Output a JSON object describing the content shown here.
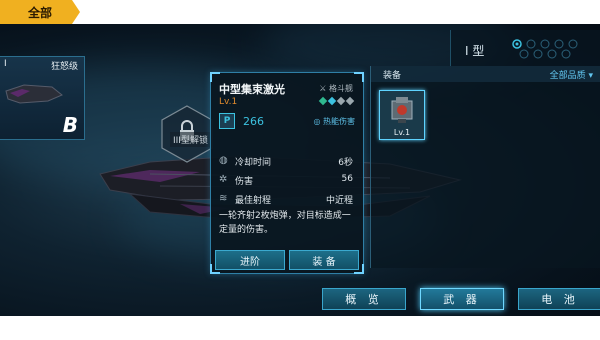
{
  "top_tab": {
    "label": "全部"
  },
  "ship_card": {
    "class_roman": "I",
    "name": "狂怒级",
    "grade": "B"
  },
  "type_selector": {
    "label": "I 型"
  },
  "locked_slot": {
    "label": "III型解锁"
  },
  "weapon": {
    "name": "中型集束激光",
    "ship_class": "格斗舰",
    "level": "Lv.1",
    "power_icon": "P",
    "power": "266",
    "damage_type": "热能伤害",
    "stats": [
      {
        "icon": "cooldown-icon",
        "label": "冷却时间",
        "value": "6秒"
      },
      {
        "icon": "damage-icon",
        "label": "伤害",
        "value": "56"
      },
      {
        "icon": "range-icon",
        "label": "最佳射程",
        "value": "中近程"
      }
    ],
    "description": "一轮齐射2枚炮弹，对目标造成一定量的伤害。",
    "buttons": {
      "upgrade": "进阶",
      "equip": "装 备"
    }
  },
  "equipment_panel": {
    "title": "装备",
    "quality_filter": "全部品质",
    "items": [
      {
        "level": "Lv.1"
      }
    ]
  },
  "bottom_tabs": [
    {
      "label": "概 览",
      "active": false
    },
    {
      "label": "武 器",
      "active": true
    },
    {
      "label": "电 池",
      "active": false
    }
  ],
  "colors": {
    "accent": "#3cc2e0",
    "tab_gold": "#f0b020",
    "level_orange": "#e08a2c"
  }
}
